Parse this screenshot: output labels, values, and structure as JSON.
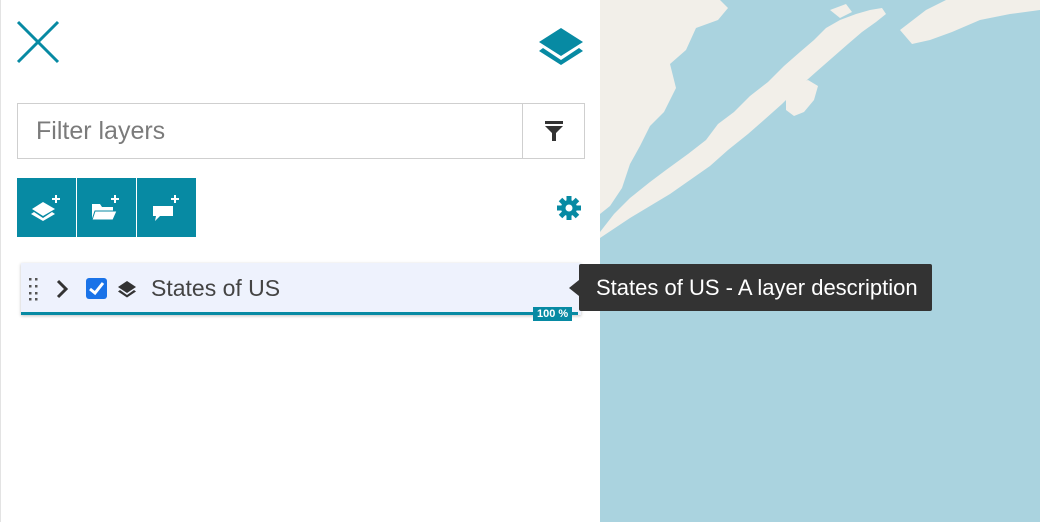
{
  "filter": {
    "placeholder": "Filter layers"
  },
  "toolbar": {
    "buttons": [
      "add-layer-icon",
      "add-group-icon",
      "add-annotation-icon"
    ]
  },
  "layer": {
    "title": "States of US",
    "opacity_label": "100 %",
    "opacity": 1.0,
    "checked": true
  },
  "tooltip": {
    "text": "States of US - A layer description"
  },
  "colors": {
    "accent": "#078aa3",
    "checkbox": "#1a73e8",
    "water": "#aad3df",
    "land": "#f2efe9",
    "tooltip": "#333333"
  },
  "icons": [
    "close-icon",
    "layers-icon",
    "filter-icon",
    "gear-icon",
    "drag-handle-icon",
    "chevron-right-icon",
    "check-icon",
    "layer-type-icon"
  ]
}
